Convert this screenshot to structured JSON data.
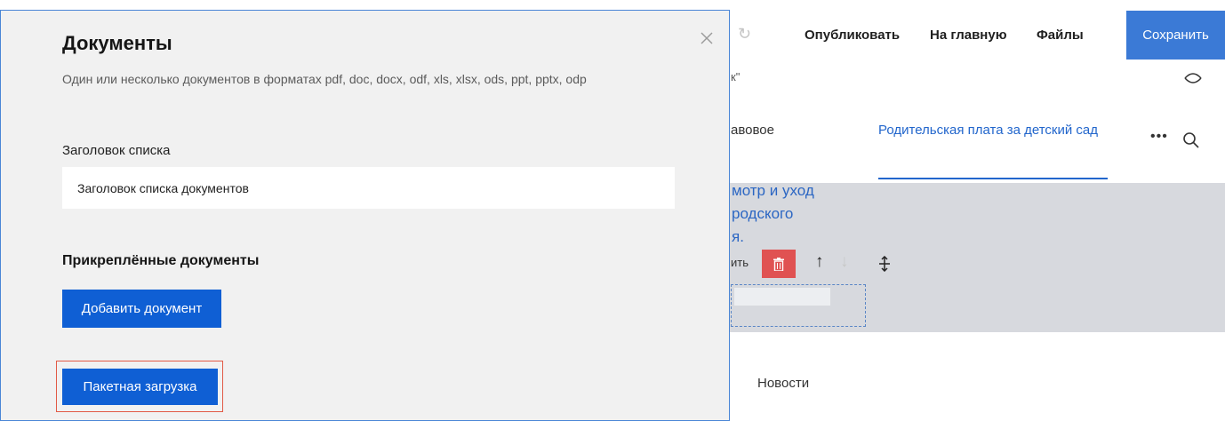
{
  "modal": {
    "title": "Документы",
    "subtitle": "Один или несколько документов в форматах pdf, doc, docx, odf, xls, xlsx, ods, ppt, pptx, odp",
    "list_title_label": "Заголовок списка",
    "list_title_value": "Заголовок списка документов",
    "attached_title": "Прикреплённые документы",
    "add_button": "Добавить документ",
    "batch_button": "Пакетная загрузка"
  },
  "toolbar": {
    "publish": "Опубликовать",
    "home": "На главную",
    "files": "Файлы",
    "save": "Сохранить"
  },
  "background": {
    "quote_fragment": "к\"",
    "tab_fragment": "авовое",
    "tab_active": "Родительская плата за детский сад",
    "link_line_1": "мотр и уход",
    "link_line_2": "родского",
    "link_line_3": "я.",
    "button_fragment": "ить",
    "news": "Новости"
  },
  "colors": {
    "accent": "#0f5fd4",
    "save_button": "#3b7ad6",
    "delete_button": "#e05252",
    "highlight_border": "#e25a46",
    "link": "#2266cc"
  }
}
